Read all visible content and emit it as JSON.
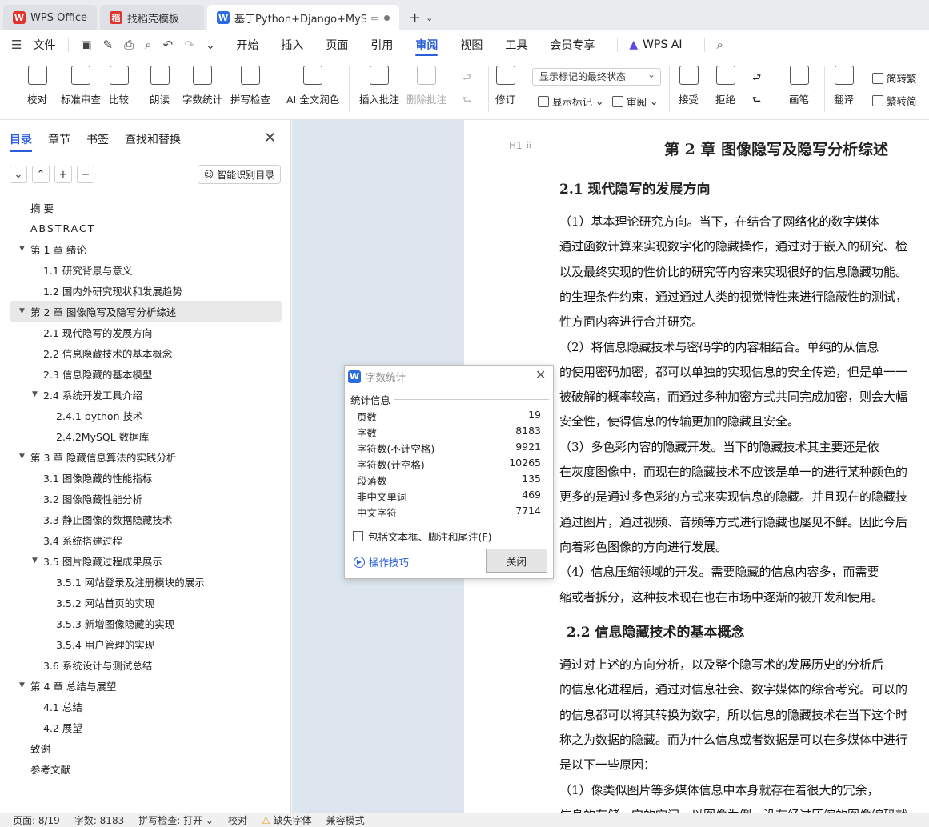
{
  "tabs": [
    {
      "label": "WPS Office",
      "logo": "W"
    },
    {
      "label": "找稻壳模板",
      "logo": "稻"
    },
    {
      "label": "基于Python+Django+MySQL",
      "logo": "W"
    }
  ],
  "menu": {
    "file": "文件",
    "items": [
      "开始",
      "插入",
      "页面",
      "引用",
      "审阅",
      "视图",
      "工具",
      "会员专享"
    ],
    "active": "审阅",
    "wps_ai": "WPS AI"
  },
  "ribbon": {
    "proofread": "校对",
    "standard_review": "标准审查",
    "compare": "比较",
    "read_aloud": "朗读",
    "word_count": "字数统计",
    "spell_check": "拼写检查",
    "ai_polish": "AI 全文润色",
    "insert_comment": "插入批注",
    "delete_comment": "删除批注",
    "track_changes": "修订",
    "markup_select": "显示标记的最终状态",
    "show_markup": "显示标记",
    "review": "审阅",
    "accept": "接受",
    "reject": "拒绝",
    "brush": "画笔",
    "translate": "翻译",
    "to_simplified": "简转繁",
    "to_traditional": "繁转简"
  },
  "nav": {
    "tabs": [
      "目录",
      "章节",
      "书签",
      "查找和替换"
    ],
    "smart_button": "智能识别目录",
    "toc": [
      {
        "label": "摘  要",
        "level": 0
      },
      {
        "label": "ABSTRACT",
        "level": 0
      },
      {
        "label": "第 1 章  绪论",
        "level": 0,
        "caret": true
      },
      {
        "label": "1.1  研究背景与意义",
        "level": 1
      },
      {
        "label": "1.2  国内外研究现状和发展趋势",
        "level": 1
      },
      {
        "label": "第 2 章  图像隐写及隐写分析综述",
        "level": 0,
        "caret": true,
        "selected": true
      },
      {
        "label": "2.1  现代隐写的发展方向",
        "level": 1
      },
      {
        "label": "2.2 信息隐藏技术的基本概念",
        "level": 1
      },
      {
        "label": "2.3 信息隐藏的基本模型",
        "level": 1
      },
      {
        "label": "2.4 系统开发工具介绍",
        "level": 1,
        "caret": true
      },
      {
        "label": "2.4.1 python 技术",
        "level": 2
      },
      {
        "label": "2.4.2MySQL 数据库",
        "level": 2
      },
      {
        "label": "第 3 章  隐藏信息算法的实践分析",
        "level": 0,
        "caret": true
      },
      {
        "label": "3.1  图像隐藏的性能指标",
        "level": 1
      },
      {
        "label": "3.2  图像隐藏性能分析",
        "level": 1
      },
      {
        "label": "3.3 静止图像的数据隐藏技术",
        "level": 1
      },
      {
        "label": "3.4  系统搭建过程",
        "level": 1
      },
      {
        "label": "3.5  图片隐藏过程成果展示",
        "level": 1,
        "caret": true
      },
      {
        "label": "3.5.1 网站登录及注册模块的展示",
        "level": 2
      },
      {
        "label": "3.5.2 网站首页的实现",
        "level": 2
      },
      {
        "label": "3.5.3 新增图像隐藏的实现",
        "level": 2
      },
      {
        "label": "3.5.4 用户管理的实现",
        "level": 2
      },
      {
        "label": "3.6 系统设计与测试总结",
        "level": 1
      },
      {
        "label": "第 4 章  总结与展望",
        "level": 0,
        "caret": true
      },
      {
        "label": "4.1 总结",
        "level": 1
      },
      {
        "label": "4.2 展望",
        "level": 1
      },
      {
        "label": "致谢",
        "level": 0
      },
      {
        "label": "参考文献",
        "level": 0
      }
    ]
  },
  "doc": {
    "h1_marker": "H1",
    "chapter": "第 2 章  图像隐写及隐写分析综述",
    "section1": "2.1  现代隐写的发展方向",
    "section2": "2.2 信息隐藏技术的基本概念",
    "lines1": [
      "        （1）基本理论研究方向。当下，在结合了网络化的数字媒体",
      "通过函数计算来实现数字化的隐藏操作，通过对于嵌入的研究、检",
      "以及最终实现的性价比的研究等内容来实现很好的信息隐藏功能。",
      "的生理条件约束，通过通过人类的视觉特性来进行隐蔽性的测试，",
      "性方面内容进行合并研究。",
      "        （2）将信息隐藏技术与密码学的内容相结合。单纯的从信息",
      "的使用密码加密，都可以单独的实现信息的安全传递，但是单一一",
      "被破解的概率较高，而通过多种加密方式共同完成加密，则会大幅",
      "安全性，使得信息的传输更加的隐藏且安全。",
      "        （3）多色彩内容的隐藏开发。当下的隐藏技术其主要还是依",
      "在灰度图像中，而现在的隐藏技术不应该是单一的进行某种颜色的",
      "更多的是通过多色彩的方式来实现信息的隐藏。并且现在的隐藏技",
      "通过图片，通过视频、音频等方式进行隐藏也屡见不鲜。因此今后",
      "向着彩色图像的方向进行发展。",
      "        （4）信息压缩领域的开发。需要隐藏的信息内容多，而需要",
      "缩或者拆分，这种技术现在也在市场中逐渐的被开发和使用。"
    ],
    "lines2": [
      "        通过对上述的方向分析，以及整个隐写术的发展历史的分析后",
      "的信息化进程后，通过对信息社会、数字媒体的综合考究。可以的",
      "的信息都可以将其转换为数字，所以信息的隐藏技术在当下这个时",
      "称之为数据的隐藏。而为什么信息或者数据是可以在多媒体中进行",
      "是以下一些原因：",
      "        （1）像类似图片等多媒体信息中本身就存在着很大的冗余，",
      "信息的存储，它的空间。以图像为例，没有经过压缩的图像编码就"
    ]
  },
  "dialog": {
    "title": "字数统计",
    "group": "统计信息",
    "stats": [
      {
        "label": "页数",
        "value": "19"
      },
      {
        "label": "字数",
        "value": "8183"
      },
      {
        "label": "字符数(不计空格)",
        "value": "9921"
      },
      {
        "label": "字符数(计空格)",
        "value": "10265"
      },
      {
        "label": "段落数",
        "value": "135"
      },
      {
        "label": "非中文单词",
        "value": "469"
      },
      {
        "label": "中文字符",
        "value": "7714"
      }
    ],
    "include_label": "包括文本框、脚注和尾注(F)",
    "tips": "操作技巧",
    "close": "关闭"
  },
  "status": {
    "page": "页面: 8/19",
    "words": "字数: 8183",
    "spell": "拼写检查: 打开",
    "proof": "校对",
    "missing_font": "缺失字体",
    "compat": "兼容模式"
  }
}
